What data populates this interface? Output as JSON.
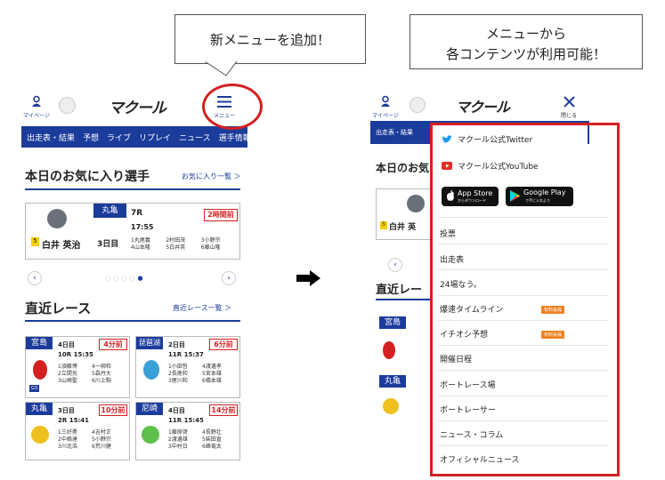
{
  "callouts": {
    "left": "新メニューを追加！",
    "right_line1": "メニューから",
    "right_line2": "各コンテンツが利用可能！"
  },
  "header": {
    "mypage_label": "マイページ",
    "logo_text": "マクール",
    "menu_label": "メニュー",
    "close_label": "閉じる"
  },
  "nav": [
    "出走表・結果",
    "予想",
    "ライブ",
    "リプレイ",
    "ニュース",
    "選手情報"
  ],
  "favorites": {
    "title": "本日のお気に入り選手",
    "link": "お気に入り一覧 ＞",
    "player_number": "5",
    "player_name": "白井 英治",
    "venue": "丸亀",
    "day": "3日目",
    "race": "7R",
    "time": "17:55",
    "countdown": "2時間前",
    "entries": [
      "1丸尾義",
      "2村田茂",
      "3小野宗",
      "4山本隆",
      "5白井英",
      "6藤山隆"
    ]
  },
  "recent": {
    "title": "直近レース",
    "link": "直近レース一覧 ＞",
    "cards": [
      {
        "venue": "宮島",
        "day": "4日目",
        "race": "10R 15:35",
        "countdown": "4分前",
        "grade": "G3",
        "entries": [
          "1須藤博",
          "4一柳和",
          "2立間充",
          "5森丹大",
          "3山崎聖",
          "6川上駒"
        ]
      },
      {
        "venue": "琵琶湖",
        "day": "2日目",
        "race": "11R 15:37",
        "countdown": "6分前",
        "grade": "",
        "entries": [
          "1小田哲",
          "4渡邊孝",
          "2長尾和",
          "5宮本雄",
          "3屋川和",
          "6橋本雄"
        ]
      },
      {
        "venue": "丸亀",
        "day": "3日目",
        "race": "2R 15:41",
        "countdown": "10分前",
        "grade": "",
        "entries": [
          "1三好勇",
          "4吉村正",
          "2中嶋達",
          "5小野宗",
          "3川北浩",
          "6荒川健"
        ]
      },
      {
        "venue": "尼崎",
        "day": "4日目",
        "race": "11R 15:45",
        "countdown": "14分前",
        "grade": "",
        "entries": [
          "1藤原啓",
          "4長野壮",
          "2渡邊雄",
          "5柴田直",
          "3中村日",
          "6峰竜太"
        ]
      }
    ]
  },
  "menu": {
    "social": [
      "マクール公式Twitter",
      "マクール公式YouTube"
    ],
    "appstore_small": "からダウンロード",
    "appstore_big": "App Store",
    "googleplay_small": "で手に入れよう",
    "googleplay_big": "Google Play",
    "items": [
      {
        "label": "投票",
        "badge": ""
      },
      {
        "label": "出走表",
        "badge": ""
      },
      {
        "label": "24場なう。",
        "badge": ""
      },
      {
        "label": "爆速タイムライン",
        "badge": "有料会員"
      },
      {
        "label": "イチオシ予想",
        "badge": "有料会員"
      },
      {
        "label": "開催日程",
        "badge": ""
      },
      {
        "label": "ボートレース場",
        "badge": ""
      },
      {
        "label": "ボートレーサー",
        "badge": ""
      },
      {
        "label": "ニュース・コラム",
        "badge": ""
      },
      {
        "label": "オフィシャルニュース",
        "badge": ""
      }
    ]
  },
  "colors": {
    "brand_blue": "#1c3c9c",
    "highlight_red": "#d42020",
    "badge_orange": "#f08020"
  }
}
